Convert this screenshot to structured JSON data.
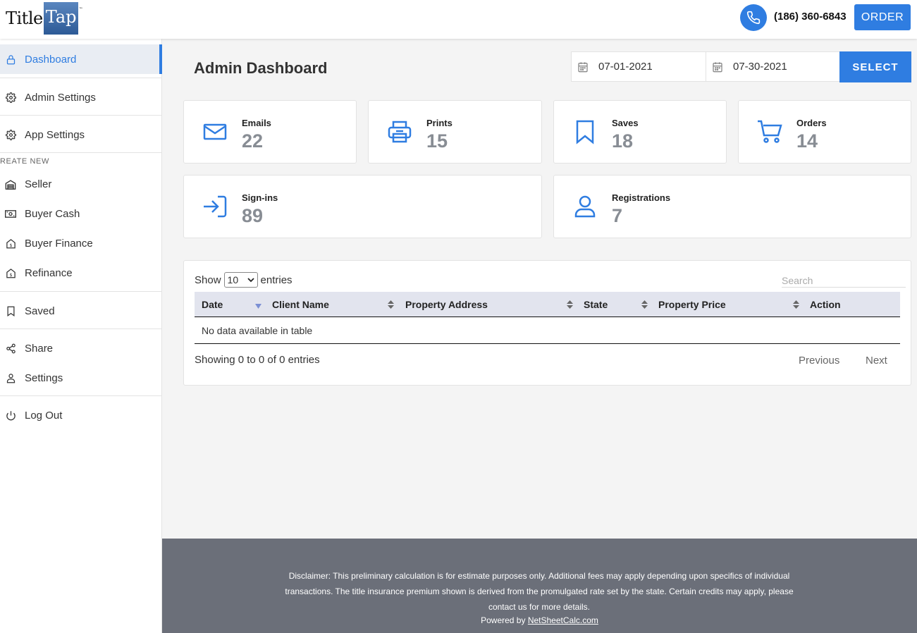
{
  "header": {
    "logo_title": "Title",
    "logo_tap": "Tap",
    "logo_tm": "™",
    "phone": "(186) 360-6843",
    "order_label": "ORDER"
  },
  "sidebar": {
    "items": [
      {
        "label": "Dashboard",
        "icon": "lock-icon",
        "active": true
      },
      {
        "label": "Admin Settings",
        "icon": "gear-icon"
      },
      {
        "label": "App Settings",
        "icon": "gear-icon"
      },
      {
        "label": "Seller",
        "icon": "building-icon"
      },
      {
        "label": "Buyer Cash",
        "icon": "cash-icon"
      },
      {
        "label": "Buyer Finance",
        "icon": "finance-icon"
      },
      {
        "label": "Refinance",
        "icon": "refinance-icon"
      },
      {
        "label": "Saved",
        "icon": "bookmark-icon"
      },
      {
        "label": "Share",
        "icon": "share-icon"
      },
      {
        "label": "Settings",
        "icon": "user-icon"
      },
      {
        "label": "Log Out",
        "icon": "power-icon"
      }
    ],
    "section_label": "REATE NEW"
  },
  "main": {
    "title": "Admin Dashboard",
    "date_from": "07-01-2021",
    "date_to": "07-30-2021",
    "select_label": "SELECT",
    "stats": [
      {
        "label": "Emails",
        "value": "22",
        "icon": "envelope-icon"
      },
      {
        "label": "Prints",
        "value": "15",
        "icon": "printer-icon"
      },
      {
        "label": "Saves",
        "value": "18",
        "icon": "bookmark-icon"
      },
      {
        "label": "Orders",
        "value": "14",
        "icon": "cart-icon"
      },
      {
        "label": "Sign-ins",
        "value": "89",
        "icon": "sign-in-icon"
      },
      {
        "label": "Registrations",
        "value": "7",
        "icon": "user-icon"
      }
    ]
  },
  "table": {
    "show_label": "Show",
    "entries_value": "10",
    "entries_label": "entries",
    "search_placeholder": "Search",
    "columns": [
      "Date",
      "Client Name",
      "Property Address",
      "State",
      "Property Price",
      "Action"
    ],
    "empty_text": "No data available in table",
    "info": "Showing 0 to 0 of 0 entries",
    "previous": "Previous",
    "next": "Next"
  },
  "footer": {
    "disclaimer": "Disclaimer: This preliminary calculation is for estimate purposes only. Additional fees may apply depending upon specifics of individual transactions. The title insurance premium shown is derived from the promulgated rate set by the state. Certain credits may apply, please contact us for more details.",
    "powered_by": "Powered by",
    "powered_link": "NetSheetCalc.com"
  },
  "colors": {
    "accent": "#2f7de1",
    "footer_bg": "#6b6f79",
    "stat_value": "#888d94"
  }
}
